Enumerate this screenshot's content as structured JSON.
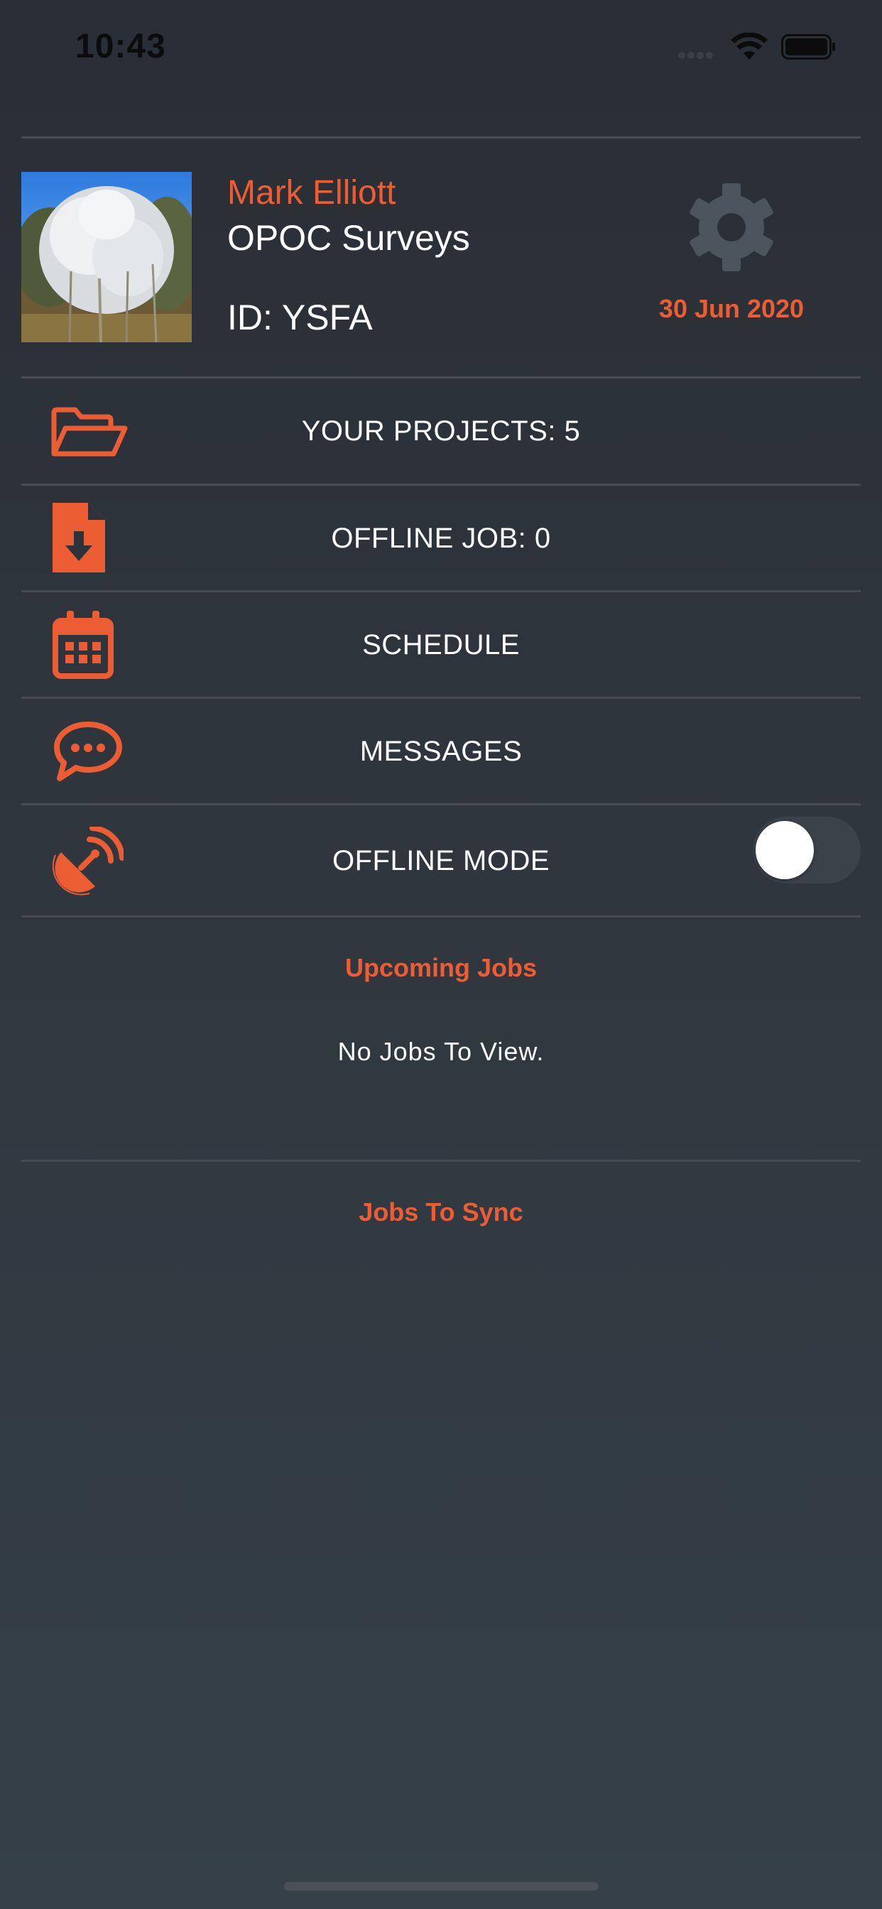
{
  "status_bar": {
    "time": "10:43",
    "icons": [
      "signal-dots-icon",
      "wifi-icon",
      "battery-icon"
    ]
  },
  "profile": {
    "name": "Mark Elliott",
    "company": "OPOC Surveys",
    "id_label": "ID: YSFA",
    "date": "30 Jun 2020",
    "avatar_icon": "tree-photo",
    "settings_icon": "gear-icon"
  },
  "menu": {
    "items": [
      {
        "label": "YOUR PROJECTS: 5",
        "icon": "folder-open-icon"
      },
      {
        "label": "OFFLINE JOB: 0",
        "icon": "file-download-icon"
      },
      {
        "label": "SCHEDULE",
        "icon": "calendar-icon"
      },
      {
        "label": "MESSAGES",
        "icon": "chat-bubble-icon"
      },
      {
        "label": "OFFLINE MODE",
        "icon": "satellite-dish-icon"
      }
    ],
    "offline_mode_enabled": false
  },
  "upcoming": {
    "title": "Upcoming Jobs",
    "empty_text": "No Jobs To View."
  },
  "sync": {
    "title": "Jobs To Sync"
  },
  "colors": {
    "accent": "#ec5d33",
    "background": "#2d333a",
    "divider": "#474c53",
    "settings_gear": "#4c555e"
  }
}
